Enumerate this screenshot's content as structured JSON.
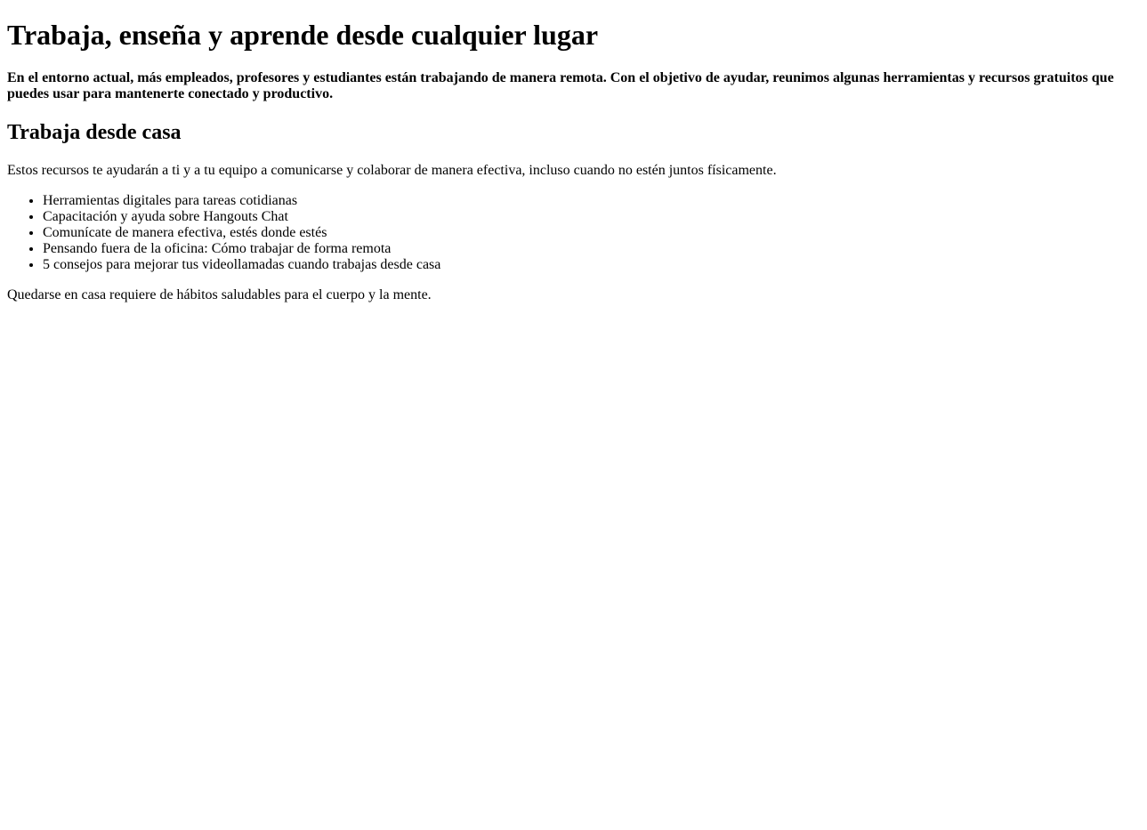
{
  "page": {
    "title": "Trabaja, enseña y aprende desde cualquier lugar",
    "intro": "En el entorno actual, más empleados, profesores y estudiantes están trabajando de manera remota. Con el objetivo de ayudar, reunimos algunas herramientas y recursos gratuitos que puedes usar para mantenerte conectado y productivo."
  },
  "section": {
    "heading": "Trabaja desde casa",
    "description": "Estos recursos te ayudarán a ti y a tu equipo a comunicarse y colaborar de manera efectiva, incluso cuando no estén juntos físicamente.",
    "items": [
      "Herramientas digitales para tareas cotidianas",
      "Capacitación y ayuda sobre Hangouts Chat",
      "Comunícate de manera efectiva, estés donde estés",
      "Pensando fuera de la oficina: Cómo trabajar de forma remota",
      "5 consejos para mejorar tus videollamadas cuando trabajas desde casa"
    ],
    "footer": "Quedarse en casa requiere de hábitos saludables para el cuerpo y la mente."
  }
}
